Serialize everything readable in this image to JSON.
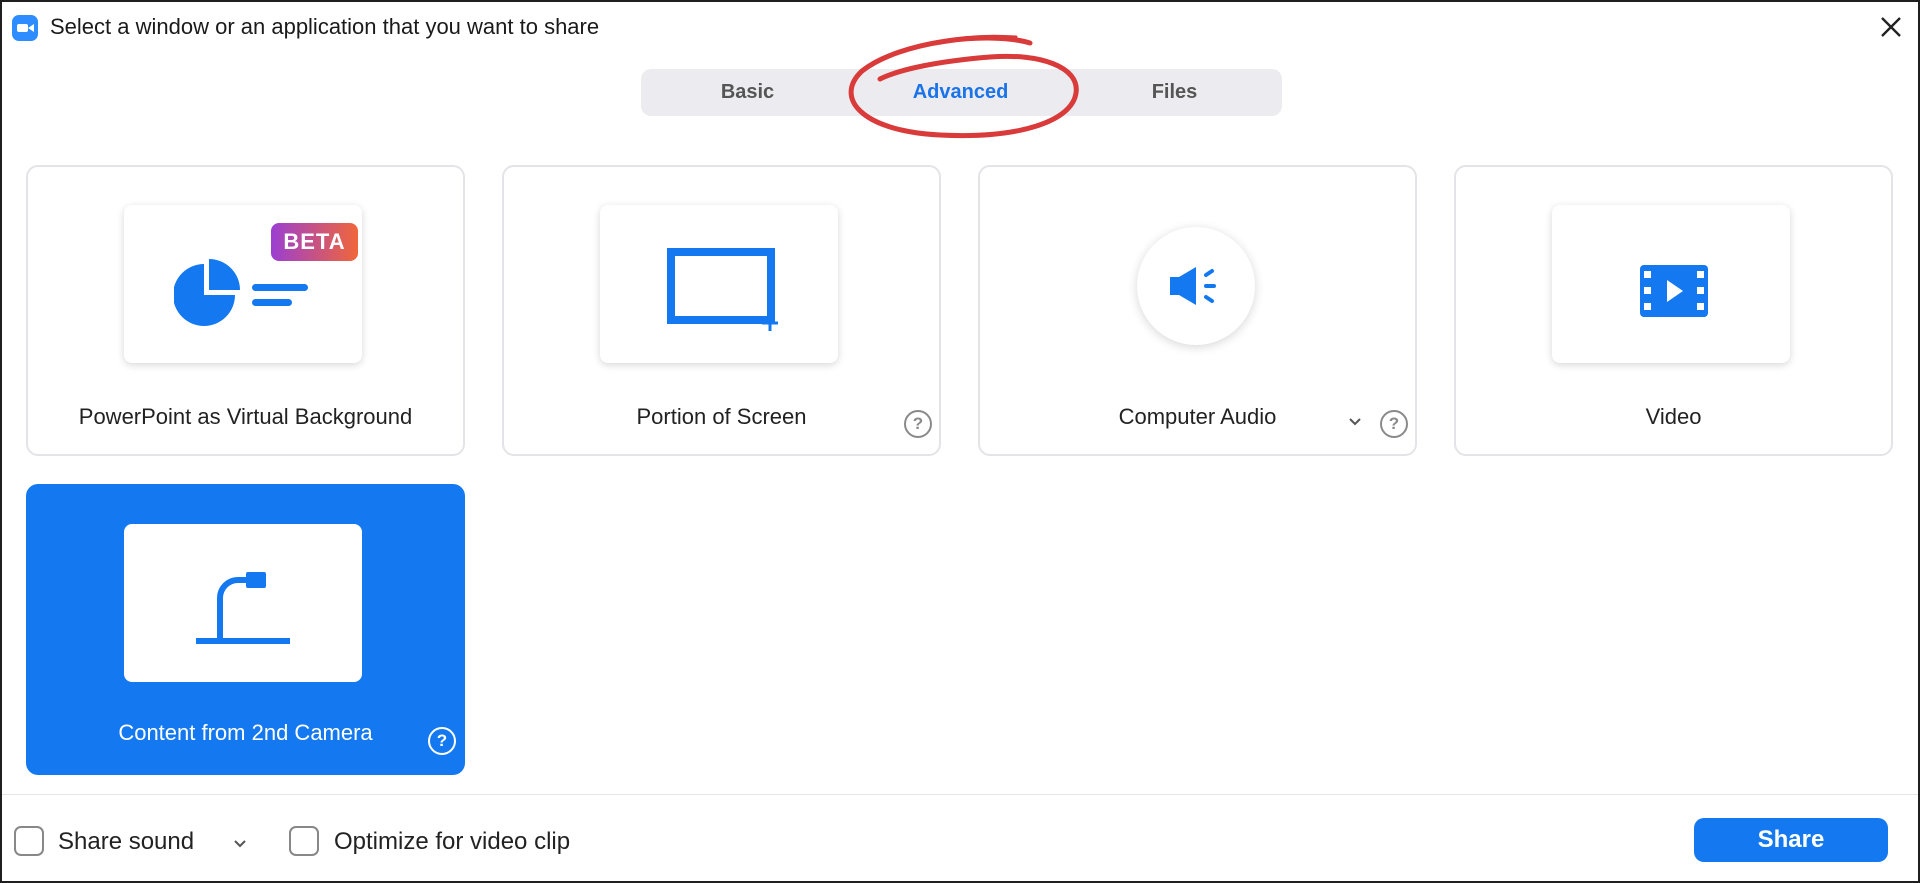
{
  "window": {
    "title": "Select a window or an application that you want to share",
    "app_icon": "zoom-camera-icon",
    "close_icon": "close-icon"
  },
  "tabs": [
    {
      "label": "Basic",
      "active": false
    },
    {
      "label": "Advanced",
      "active": true
    },
    {
      "label": "Files",
      "active": false
    }
  ],
  "annotation": {
    "color": "#d93a3a",
    "target": "Advanced"
  },
  "options": [
    {
      "label": "PowerPoint as Virtual Background",
      "icon": "pie-chart-icon",
      "badge": "BETA",
      "help": false,
      "selected": false
    },
    {
      "label": "Portion of Screen",
      "icon": "screen-portion-icon",
      "help": true,
      "selected": false
    },
    {
      "label": "Computer Audio",
      "icon": "speaker-icon",
      "help": true,
      "dropdown": true,
      "selected": false
    },
    {
      "label": "Video",
      "icon": "film-play-icon",
      "help": false,
      "selected": false
    },
    {
      "label": "Content from 2nd Camera",
      "icon": "document-camera-icon",
      "help": true,
      "selected": true
    }
  ],
  "help_glyph": "?",
  "footer": {
    "share_sound_label": "Share sound",
    "share_sound_checked": false,
    "optimize_label": "Optimize for video clip",
    "optimize_checked": false,
    "share_button": "Share"
  },
  "colors": {
    "accent": "#1479f0",
    "icon_blue": "#2d8cff",
    "beta_gradient_start": "#9b3fd1",
    "beta_gradient_end": "#f0663a",
    "annotation_red": "#d93a3a"
  }
}
